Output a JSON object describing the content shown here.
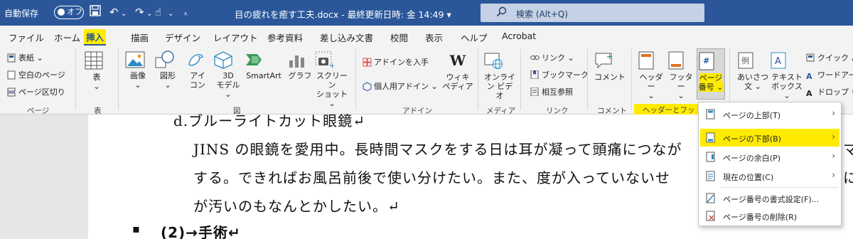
{
  "titlebar": {
    "autosave_label": "自動保存",
    "autosave_state": "オフ",
    "doc_title": "目の疲れを癒す工夫.docx  -  最終更新日時: 金 14:49  ▾",
    "search_placeholder": "検索 (Alt+Q)"
  },
  "tabs": [
    "ファイル",
    "ホーム",
    "挿入",
    "描画",
    "デザイン",
    "レイアウト",
    "参考資料",
    "差し込み文書",
    "校閲",
    "表示",
    "ヘルプ",
    "Acrobat"
  ],
  "ribbon": {
    "page_group": {
      "cover": "表紙 ⌄",
      "blank": "空白のページ",
      "break": "ページ区切り",
      "label": "ページ"
    },
    "table_group": {
      "table": "表",
      "label": "表"
    },
    "illustrations": {
      "image": "画像",
      "shapes": "図形",
      "icons1": "アイ",
      "icons2": "コン",
      "model1": "3D",
      "model2": "モデル ⌄",
      "smartart": "SmartArt",
      "graph": "グラフ",
      "screenshot1": "スクリーン",
      "screenshot2": "ショット ⌄",
      "label": "図"
    },
    "addins": {
      "get": "アドインを入手",
      "personal": "個人用アドイン ⌄",
      "wiki1": "ウィキ",
      "wiki2": "ペディア",
      "label": "アドイン"
    },
    "media": {
      "online1": "オンライ",
      "online2": "ン ビデオ",
      "label": "メディア"
    },
    "links": {
      "link": "リンク ⌄",
      "bookmark": "ブックマーク",
      "crossref": "相互参照",
      "label": "リンク"
    },
    "comments": {
      "comment": "コメント",
      "label": "コメント"
    },
    "hf": {
      "header": "ヘッダー",
      "footer": "フッター",
      "pagenum1": "ページ",
      "pagenum2": "番号 ⌄",
      "label": "ヘッダーとフッ"
    },
    "text": {
      "greet1": "あいさつ",
      "greet2": "文 ⌄",
      "textbox1": "テキスト",
      "textbox2": "ボックス ⌄",
      "quick": "クイック パ",
      "wordart": "ワードアー",
      "dropcap": "ドロップ キ"
    }
  },
  "document": {
    "heading": "d.ブルーライトカット眼鏡↵",
    "para1": "JINS の眼鏡を愛用中。長時間マスクをする日は耳が凝って頭痛につなが",
    "para2": "する。できればお風呂前後で使い分けたい。また、度が入っていないせ",
    "para3": "が汚いのもなんとかしたい。↵",
    "bullet": "▪",
    "section": "(2)→手術↵",
    "right1": "マ",
    "right2": "にて"
  },
  "menu": {
    "items": [
      {
        "label": "ページの上部(T)",
        "has_sub": true
      },
      {
        "label": "ページの下部(B)",
        "has_sub": true
      },
      {
        "label": "ページの余白(P)",
        "has_sub": true
      },
      {
        "label": "現在の位置(C)",
        "has_sub": true
      },
      {
        "label": "ページ番号の書式設定(F)...",
        "has_sub": false
      },
      {
        "label": "ページ番号の削除(R)",
        "has_sub": false
      }
    ]
  },
  "colors": {
    "brand": "#2b579a",
    "highlight": "#ffeb00"
  }
}
